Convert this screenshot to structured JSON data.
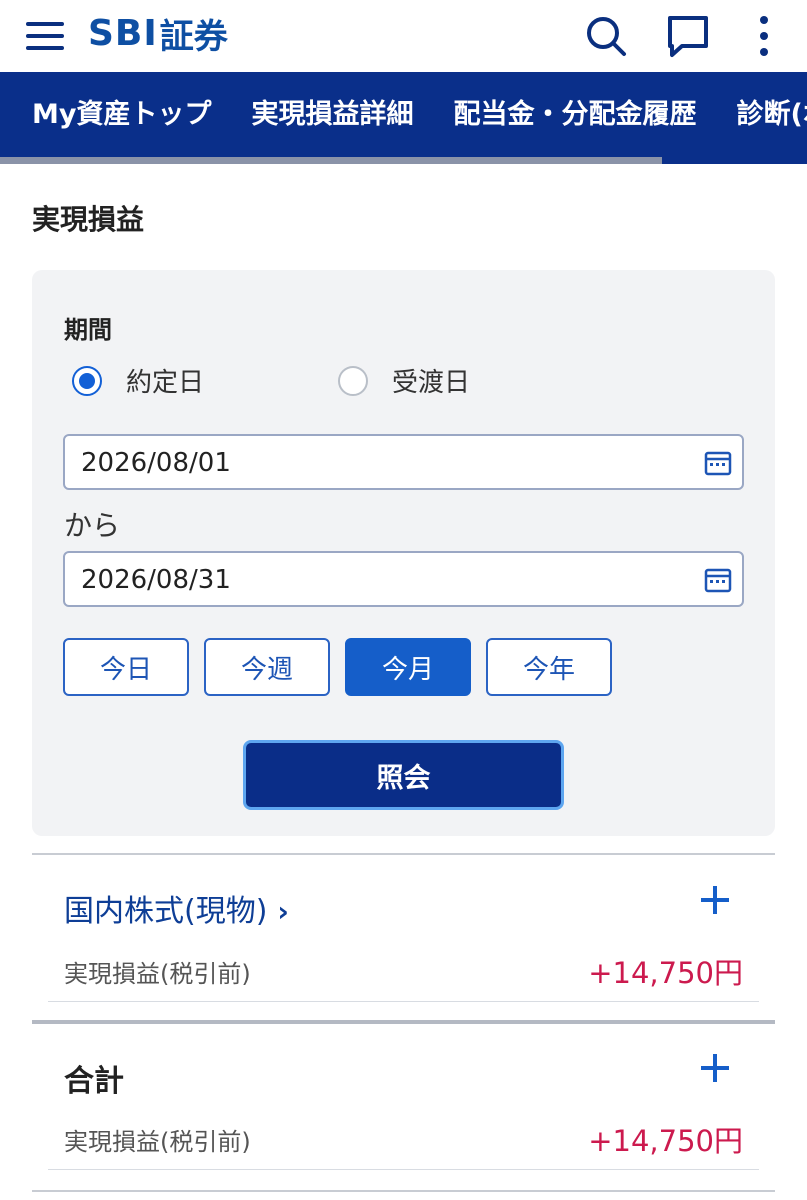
{
  "header": {
    "logo_sbi": "SBI",
    "logo_text": "証券",
    "icons": [
      "menu-icon",
      "search-icon",
      "chat-icon",
      "more-icon"
    ]
  },
  "nav": {
    "tabs": [
      {
        "label": "My資産トップ"
      },
      {
        "label": "実現損益詳細"
      },
      {
        "label": "配当金・分配金履歴"
      },
      {
        "label": "診断(ポ"
      }
    ]
  },
  "page": {
    "title": "実現損益"
  },
  "filter": {
    "period_label": "期間",
    "radio_trade": "約定日",
    "radio_settle": "受渡日",
    "selected": "約定日",
    "date_from": "2026/08/01",
    "separator": "から",
    "date_to": "2026/08/31",
    "quick": [
      "今日",
      "今週",
      "今月",
      "今年"
    ],
    "quick_active": "今月",
    "submit_label": "照会"
  },
  "results": {
    "domestic": {
      "title": "国内株式(現物)",
      "chevron": "›",
      "label": "実現損益(税引前)",
      "value": "+14,750円"
    },
    "total": {
      "title": "合計",
      "label": "実現損益(税引前)",
      "value": "+14,750円"
    }
  },
  "colors": {
    "brand_navy": "#0a2f8a",
    "accent_blue": "#155ec9",
    "profit_red": "#cc1a4e"
  }
}
